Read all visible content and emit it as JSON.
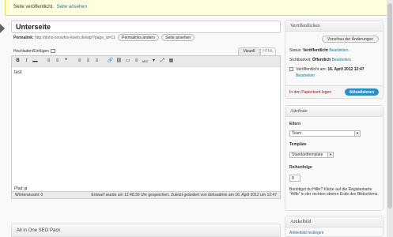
{
  "notice": {
    "text": "Seite veröffentlicht.",
    "link": "Seite ansehen"
  },
  "title": {
    "value": "Unterseite"
  },
  "permalink": {
    "label": "Permalink:",
    "url": "http://dohs-snowfox-koeln.de/wp/?page_id=11",
    "change_button": "Permalinks ändern",
    "view_button": "Seite ansehen"
  },
  "media": {
    "label": "Hochladen/Einfügen"
  },
  "editor": {
    "tab_visual": "Visuell",
    "tab_html": "HTML",
    "content": "test",
    "toolbar": [
      "B",
      "I",
      "abc",
      "≡",
      "≡",
      "❝",
      "≡",
      "≡",
      "≡",
      "🔗",
      "⛓",
      "▭",
      "≡",
      "ABC",
      "▾",
      "⤢",
      "▦"
    ],
    "path_label": "Pfad:",
    "path_value": "p",
    "wordcount": "Wörteranzahl: 0",
    "draft_status": "Entwurf wurde um 12:48:30 Uhr gespeichert. Zuletzt geändert von dohsadmin am 16. April 2012 um 12:47"
  },
  "seo": {
    "title": "All in One SEO Pack"
  },
  "publish": {
    "title": "Veröffentlichen",
    "preview_button": "Vorschau der Änderungen",
    "status_label": "Status:",
    "status_value": "Veröffentlicht",
    "status_edit": "Bearbeiten",
    "visibility_label": "Sichtbarkeit:",
    "visibility_value": "Öffentlich",
    "visibility_edit": "Bearbeiten",
    "published_label": "Veröffentlicht am:",
    "published_value": "16. April 2012 12:47",
    "published_edit": "Bearbeiten",
    "trash_link": "In den Papierkorb legen",
    "update_button": "Aktualisieren"
  },
  "attributes": {
    "title": "Attribute",
    "parent_label": "Eltern",
    "parent_value": "Team",
    "template_label": "Template",
    "template_value": "Standardtemplate",
    "order_label": "Reihenfolge",
    "order_value": "0",
    "help_text": "Benötigst du Hilfe? Klicke auf die Registerkarte \"Hilfe\" in der rechten oberen Ecke des Bildschirms."
  },
  "featured_image": {
    "title": "Artikelbild",
    "link": "Artikelbild festlegen"
  }
}
